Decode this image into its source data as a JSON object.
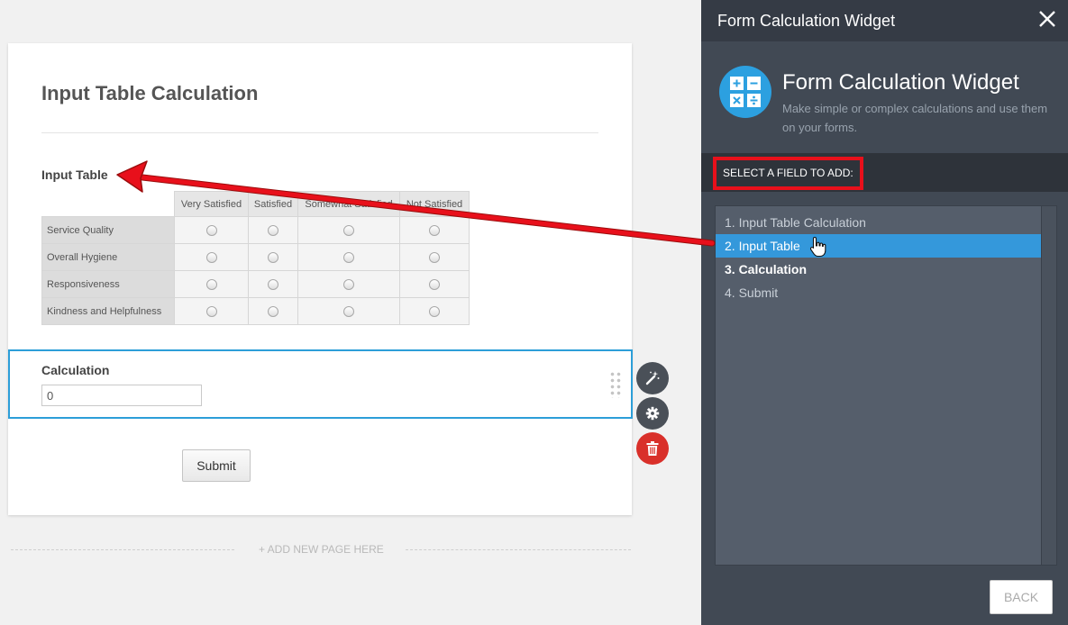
{
  "form": {
    "title": "Input Table Calculation",
    "table_label": "Input Table",
    "columns": [
      "Very Satisfied",
      "Satisfied",
      "Somewhat Satisfied",
      "Not Satisfied"
    ],
    "rows": [
      "Service Quality",
      "Overall Hygiene",
      "Responsiveness",
      "Kindness and Helpfulness"
    ],
    "calculation_label": "Calculation",
    "calculation_value": "0",
    "submit_label": "Submit",
    "add_page_label": "+ ADD NEW PAGE HERE"
  },
  "tools": {
    "icons": [
      "magic-wand-icon",
      "gear-icon",
      "trash-icon"
    ],
    "delete_color": "#d9302a"
  },
  "panel": {
    "header_title": "Form Calculation Widget",
    "widget_name": "Form Calculation Widget",
    "widget_description": "Make simple or complex calculations and use them on your forms.",
    "select_label": "SELECT A FIELD TO ADD:",
    "fields": [
      {
        "label": "1. Input Table Calculation",
        "state": "normal"
      },
      {
        "label": "2. Input Table",
        "state": "active"
      },
      {
        "label": "3. Calculation",
        "state": "bold"
      },
      {
        "label": "4. Submit",
        "state": "normal"
      }
    ],
    "back_label": "BACK"
  },
  "colors": {
    "accent_blue": "#3498db",
    "highlight_red": "#e8101b",
    "panel_bg": "#414954"
  }
}
